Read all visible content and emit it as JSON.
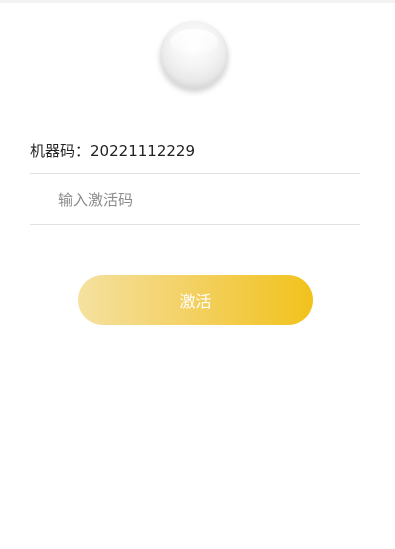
{
  "machine": {
    "label": "机器码：",
    "value": "20221112229"
  },
  "activation_input": {
    "placeholder": "输入激活码",
    "value": ""
  },
  "activate_button": {
    "label": "激活"
  },
  "colors": {
    "button_gradient_start": "#f5e1a0",
    "button_gradient_end": "#f2c21c",
    "button_text": "#ffffff",
    "divider": "#e2e2e2"
  },
  "icons": {
    "logo": "white-sphere-logo"
  }
}
